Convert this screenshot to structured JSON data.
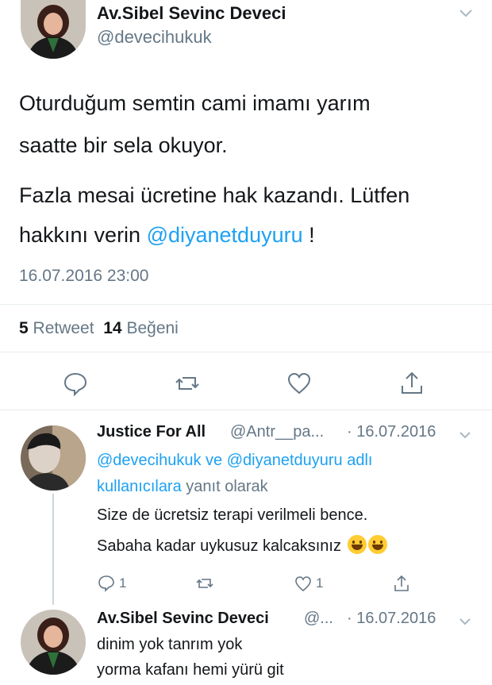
{
  "tweet": {
    "author_name": "Av.Sibel Sevinc Deveci",
    "author_handle": "@devecihukuk",
    "text_line1": "Oturduğum semtin cami imamı yarım",
    "text_line2": "saatte bir sela okuyor.",
    "text_line3": "Fazla mesai ücretine hak kazandı. Lütfen",
    "text_line4_prefix": "hakkını verin ",
    "text_line4_mention": "@diyanetduyuru",
    "text_line4_suffix": " !",
    "timestamp": "16.07.2016 23:00",
    "retweet_count": "5",
    "retweet_label": "Retweet",
    "like_count": "14",
    "like_label": "Beğeni"
  },
  "replies": [
    {
      "author_name": "Justice For All",
      "author_handle": "@Antr__pa...",
      "date": "· 16.07.2016",
      "context_mention1": "@devecihukuk",
      "context_and": " ve ",
      "context_mention2": "@diyanetduyuru",
      "context_adli": " adlı",
      "context_users": "kullanıcılara",
      "context_suffix": " yanıt olarak",
      "text_line1": "Size de ücretsiz terapi verilmeli bence.",
      "text_line2": "Sabaha kadar uykusuz kalcaksınız",
      "reply_count": "1",
      "like_count": "1"
    },
    {
      "author_name": "Av.Sibel Sevinc Deveci",
      "author_handle": "@...",
      "date": "· 16.07.2016",
      "text_line1": "dinim yok tanrım yok",
      "text_line2": "yorma kafanı hemi yürü git"
    }
  ],
  "icons": {
    "chevron": "chevron-down-icon",
    "reply": "reply-icon",
    "retweet": "retweet-icon",
    "like": "heart-icon",
    "share": "share-icon"
  },
  "colors": {
    "accent": "#1da1f2",
    "secondary_text": "#657786",
    "divider": "#e6ecf0"
  }
}
